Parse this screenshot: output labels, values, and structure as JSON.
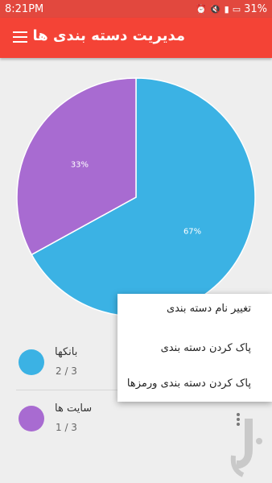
{
  "status_bar": {
    "time": "8:21PM",
    "battery": "31%",
    "icons": [
      "alarm-icon",
      "mute-icon",
      "signal-icon",
      "battery-icon"
    ]
  },
  "app_bar": {
    "title": "مدیریت دسته بندی ها",
    "menu_icon": "hamburger-menu-icon"
  },
  "colors": {
    "appbar": "#f44336",
    "statusbar": "#e2483e",
    "series_blue": "#3bb2e4",
    "series_purple": "#a86bd1"
  },
  "chart_data": {
    "type": "pie",
    "slices": [
      {
        "label": "67%",
        "value": 67,
        "color": "#3bb2e4"
      },
      {
        "label": "33%",
        "value": 33,
        "color": "#a86bd1"
      }
    ]
  },
  "legend": [
    {
      "name": "بانکها",
      "count": "2 / 3",
      "color": "#3bb2e4"
    },
    {
      "name": "سایت ها",
      "count": "1 / 3",
      "color": "#a86bd1"
    }
  ],
  "popup_menu": {
    "items": [
      "تغییر نام دسته بندی",
      "پاک کردن دسته بندی",
      "پاک کردن دسته بندی ورمزها"
    ]
  }
}
